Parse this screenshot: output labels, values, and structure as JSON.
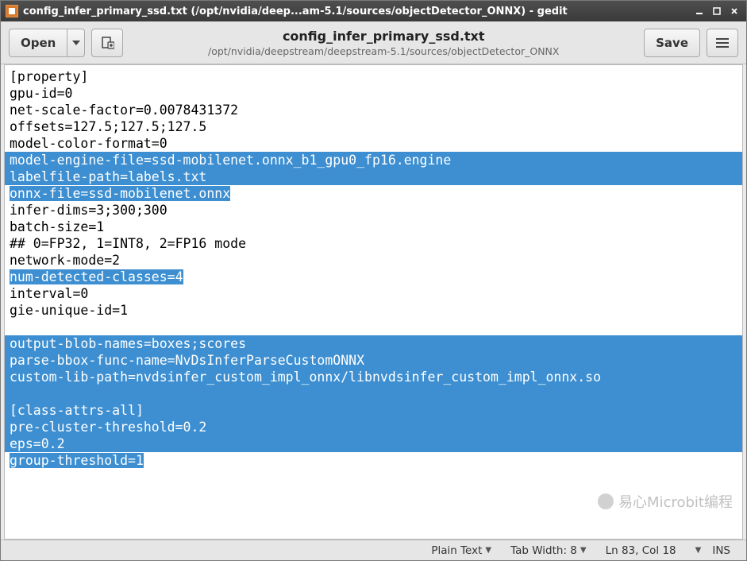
{
  "window": {
    "title": "config_infer_primary_ssd.txt (/opt/nvidia/deep...am-5.1/sources/objectDetector_ONNX) - gedit"
  },
  "toolbar": {
    "open_label": "Open",
    "file_name": "config_infer_primary_ssd.txt",
    "file_path": "/opt/nvidia/deepstream/deepstream-5.1/sources/objectDetector_ONNX",
    "save_label": "Save"
  },
  "content": {
    "lines": [
      {
        "text": "[property]",
        "hl": false
      },
      {
        "text": "gpu-id=0",
        "hl": false
      },
      {
        "text": "net-scale-factor=0.0078431372",
        "hl": false
      },
      {
        "text": "offsets=127.5;127.5;127.5",
        "hl": false
      },
      {
        "text": "model-color-format=0",
        "hl": false
      },
      {
        "text": "model-engine-file=ssd-mobilenet.onnx_b1_gpu0_fp16.engine",
        "hl": true,
        "full": true
      },
      {
        "text": "labelfile-path=labels.txt",
        "hl": true,
        "full": true
      },
      {
        "text": "onnx-file=ssd-mobilenet.onnx",
        "hl": true,
        "full": false
      },
      {
        "text": "infer-dims=3;300;300",
        "hl": false
      },
      {
        "text": "batch-size=1",
        "hl": false
      },
      {
        "text": "## 0=FP32, 1=INT8, 2=FP16 mode",
        "hl": false
      },
      {
        "text": "network-mode=2",
        "hl": false
      },
      {
        "text": "num-detected-classes=4",
        "hl": true,
        "full": false
      },
      {
        "text": "interval=0",
        "hl": false
      },
      {
        "text": "gie-unique-id=1",
        "hl": false
      },
      {
        "text": "",
        "hl": false
      },
      {
        "text": "output-blob-names=boxes;scores",
        "hl": true,
        "full": true
      },
      {
        "text": "parse-bbox-func-name=NvDsInferParseCustomONNX",
        "hl": true,
        "full": true
      },
      {
        "text": "custom-lib-path=nvdsinfer_custom_impl_onnx/libnvdsinfer_custom_impl_onnx.so",
        "hl": true,
        "full": true
      },
      {
        "text": "",
        "hl": true,
        "full": true
      },
      {
        "text": "[class-attrs-all]",
        "hl": true,
        "full": true
      },
      {
        "text": "pre-cluster-threshold=0.2",
        "hl": true,
        "full": true
      },
      {
        "text": "eps=0.2",
        "hl": true,
        "full": true
      },
      {
        "text": "group-threshold=1",
        "hl": true,
        "full": false
      }
    ]
  },
  "statusbar": {
    "syntax": "Plain Text",
    "tab_width_label": "Tab Width: 8",
    "position": "Ln 83, Col 18",
    "mode": "INS"
  },
  "watermark": {
    "text": "易心Microbit编程"
  }
}
